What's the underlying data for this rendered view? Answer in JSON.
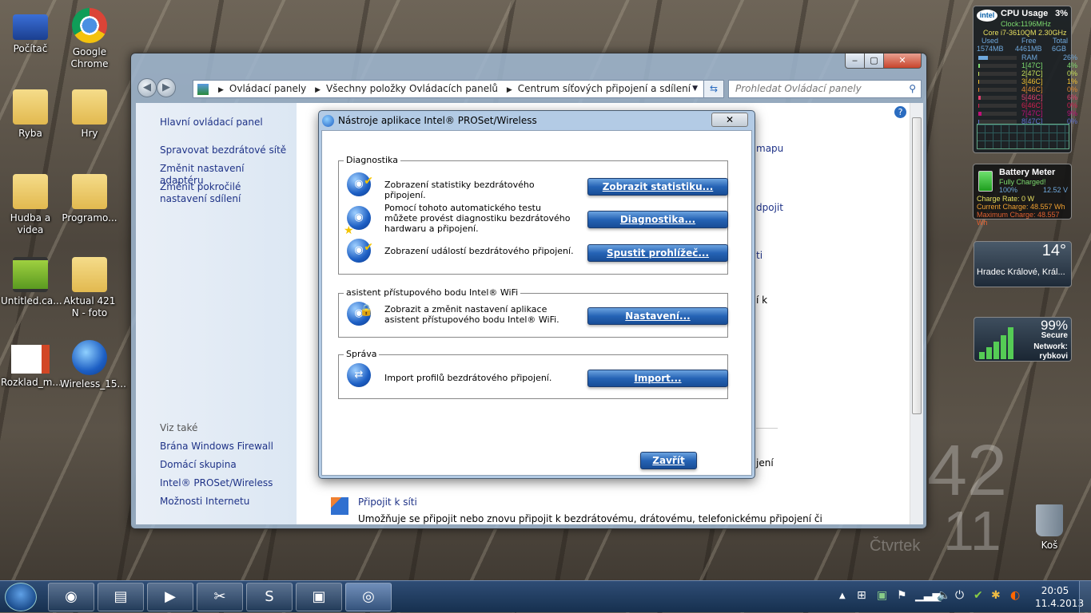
{
  "desktop_icons": [
    {
      "label": "Počítač",
      "kind": "computer"
    },
    {
      "label": "Google Chrome",
      "kind": "chrome"
    },
    {
      "label": "Ryba",
      "kind": "user-folder"
    },
    {
      "label": "Hry",
      "kind": "games-folder"
    },
    {
      "label": "Hudba a videa",
      "kind": "folder"
    },
    {
      "label": "Programo...",
      "kind": "folder"
    },
    {
      "label": "Untitled.ca...",
      "kind": "video-file"
    },
    {
      "label": "Aktual 421 N - foto",
      "kind": "folder"
    },
    {
      "label": "Rozklad_m...",
      "kind": "powerpoint-file"
    },
    {
      "label": "Wireless_15...",
      "kind": "wireless-installer"
    },
    {
      "label": "Koš",
      "kind": "recycle-bin"
    }
  ],
  "explorer": {
    "breadcrumb": [
      "Ovládací panely",
      "Všechny položky Ovládacích panelů",
      "Centrum síťových připojení a sdílení"
    ],
    "search_placeholder": "Prohledat Ovládací panely",
    "left_pane": {
      "links": [
        "Hlavní ovládací panel",
        "Spravovat bezdrátové sítě",
        "Změnit nastavení adaptéru",
        "Změnit pokročilé nastavení sdílení"
      ],
      "see_also_title": "Viz také",
      "see_also": [
        "Brána Windows Firewall",
        "Domácí skupina",
        "Intel® PROSet/Wireless",
        "Možnosti Internetu"
      ]
    },
    "background_fragments": [
      "mapu",
      "dpojit",
      "ti",
      "í k",
      "jení"
    ],
    "connect_link": "Připojit k síti",
    "connect_desc": "Umožňuje se připojit nebo znovu připojit k bezdrátovému, drátovému, telefonickému připojení či"
  },
  "dialog": {
    "title": "Nástroje aplikace Intel® PROSet/Wireless",
    "close_label": "Zavřít",
    "groups": [
      {
        "title": "Diagnostika",
        "rows": [
          {
            "text": "Zobrazení statistiky bezdrátového připojení.",
            "button": "Zobrazit statistiku..."
          },
          {
            "text": "Pomocí tohoto automatického testu můžete provést diagnostiku bezdrátového hardwaru a připojení.",
            "button": "Diagnostika..."
          },
          {
            "text": "Zobrazení událostí bezdrátového připojení.",
            "button": "Spustit prohlížeč..."
          }
        ]
      },
      {
        "title": "asistent přístupového bodu Intel® WiFi",
        "rows": [
          {
            "text": "Zobrazit a změnit nastavení aplikace asistent přístupového bodu Intel® WiFi.",
            "button": "Nastavení..."
          }
        ]
      },
      {
        "title": "Správa",
        "rows": [
          {
            "text": "Import profilů bezdrátového připojení.",
            "button": "Import..."
          }
        ]
      }
    ]
  },
  "cpu_gadget": {
    "title": "CPU Usage",
    "total": "3%",
    "clock": "Clock:1196MHz",
    "cpu": "Core i7-3610QM 2.30GHz",
    "mem_headers": [
      "Used",
      "Free",
      "Total"
    ],
    "mem_values": [
      "1574MB",
      "4461MB",
      "6GB"
    ],
    "rows": [
      {
        "label": "RAM",
        "pct": "26%",
        "value": 26,
        "color": "#6fa8dc"
      },
      {
        "label": "1[47C]",
        "pct": "4%",
        "value": 4,
        "color": "#7ddc6f"
      },
      {
        "label": "2[47C]",
        "pct": "0%",
        "value": 0,
        "color": "#c6e05a"
      },
      {
        "label": "3[46C]",
        "pct": "1%",
        "value": 1,
        "color": "#f0c030"
      },
      {
        "label": "4[46C]",
        "pct": "0%",
        "value": 0,
        "color": "#e08a30"
      },
      {
        "label": "5[46C]",
        "pct": "6%",
        "value": 6,
        "color": "#e04070"
      },
      {
        "label": "6[46C]",
        "pct": "0%",
        "value": 0,
        "color": "#d02050"
      },
      {
        "label": "7[47C]",
        "pct": "9%",
        "value": 9,
        "color": "#c0107a"
      },
      {
        "label": "8[47C]",
        "pct": "0%",
        "value": 0,
        "color": "#6070d0"
      }
    ]
  },
  "battery_gadget": {
    "title": "Battery Meter",
    "status": "Fully Charged!",
    "percent": "100%",
    "voltage": "12.52 V",
    "charge_rate": "Charge Rate: 0 W",
    "current": "Current Charge: 48.557 Wh",
    "maximum": "Maximum Charge: 48.557 Wh"
  },
  "weather_gadget": {
    "temp": "14°",
    "location": "Hradec Králové, Král..."
  },
  "network_gadget": {
    "signal": "99%",
    "security": "Secure",
    "network_label": "Network:",
    "network_name": "rybkovi"
  },
  "desktop_clock": {
    "minute": "42",
    "hour": "11",
    "day": "Čtvrtek"
  },
  "taskbar": {
    "time": "20:05",
    "date": "11.4.2013"
  }
}
